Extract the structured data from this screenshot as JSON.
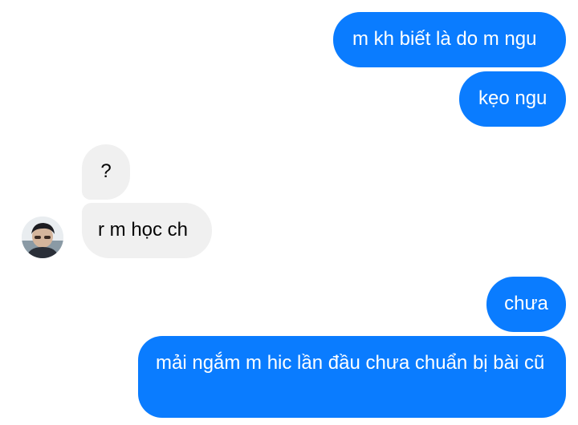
{
  "messages": [
    {
      "text": "m kh biết là do m ngu",
      "direction": "outgoing"
    },
    {
      "text": "kẹo ngu",
      "direction": "outgoing"
    },
    {
      "text": "?",
      "direction": "incoming"
    },
    {
      "text": "r m học ch",
      "direction": "incoming"
    },
    {
      "text": "chưa",
      "direction": "outgoing"
    },
    {
      "text": "mải ngắm m hic lần đầu chưa chuẩn bị bài cũ",
      "direction": "outgoing"
    }
  ],
  "avatar": {
    "icon": "user-avatar"
  },
  "colors": {
    "outgoing": "#0a7cff",
    "incoming": "#f0f0f0",
    "outgoing_text": "#ffffff",
    "incoming_text": "#050505"
  }
}
